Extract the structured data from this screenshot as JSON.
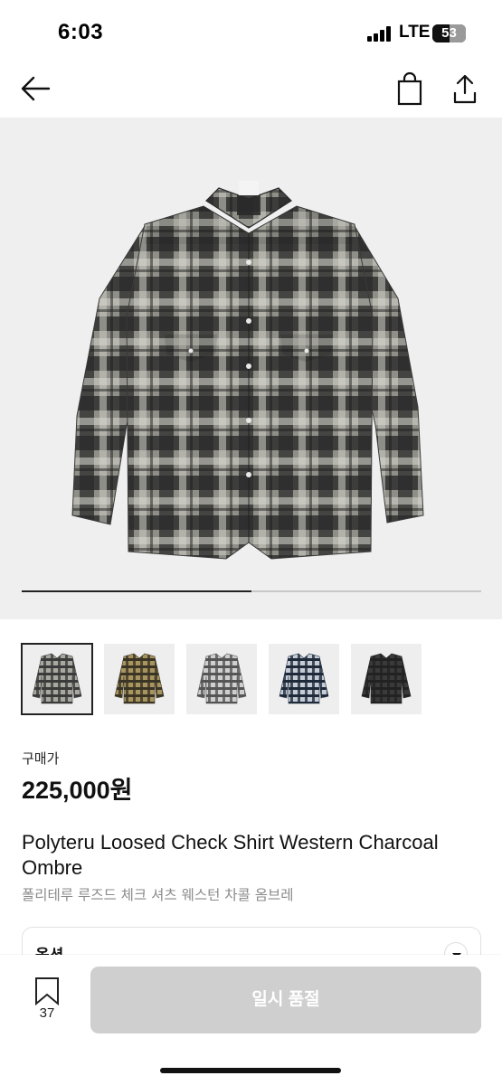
{
  "status_bar": {
    "time": "6:03",
    "network": "LTE",
    "battery": "53"
  },
  "nav": {
    "back_icon": "arrow-left-icon",
    "bag_icon": "shopping-bag-icon",
    "share_icon": "share-icon"
  },
  "gallery": {
    "progress": 0.5,
    "thumbnails": [
      {
        "name": "charcoal-ombre",
        "colors": [
          "#3b3b3b",
          "#a8a8a0"
        ]
      },
      {
        "name": "olive",
        "colors": [
          "#3a3425",
          "#a8945e"
        ]
      },
      {
        "name": "grey",
        "colors": [
          "#555555",
          "#cfcfcf"
        ]
      },
      {
        "name": "navy",
        "colors": [
          "#1e2a3a",
          "#c5ccd6"
        ]
      },
      {
        "name": "black",
        "colors": [
          "#222222",
          "#3a3a3a"
        ]
      }
    ]
  },
  "price": {
    "label": "구매가",
    "value": "225,000원"
  },
  "product": {
    "title_en": "Polyteru Loosed Check Shirt Western Charcoal Ombre",
    "title_ko": "폴리테루 루즈드 체크 셔츠 웨스턴 차콜 옴브레"
  },
  "option": {
    "label": "옵션"
  },
  "bottom_bar": {
    "wish_count": "37",
    "cta_label": "일시 품절"
  }
}
